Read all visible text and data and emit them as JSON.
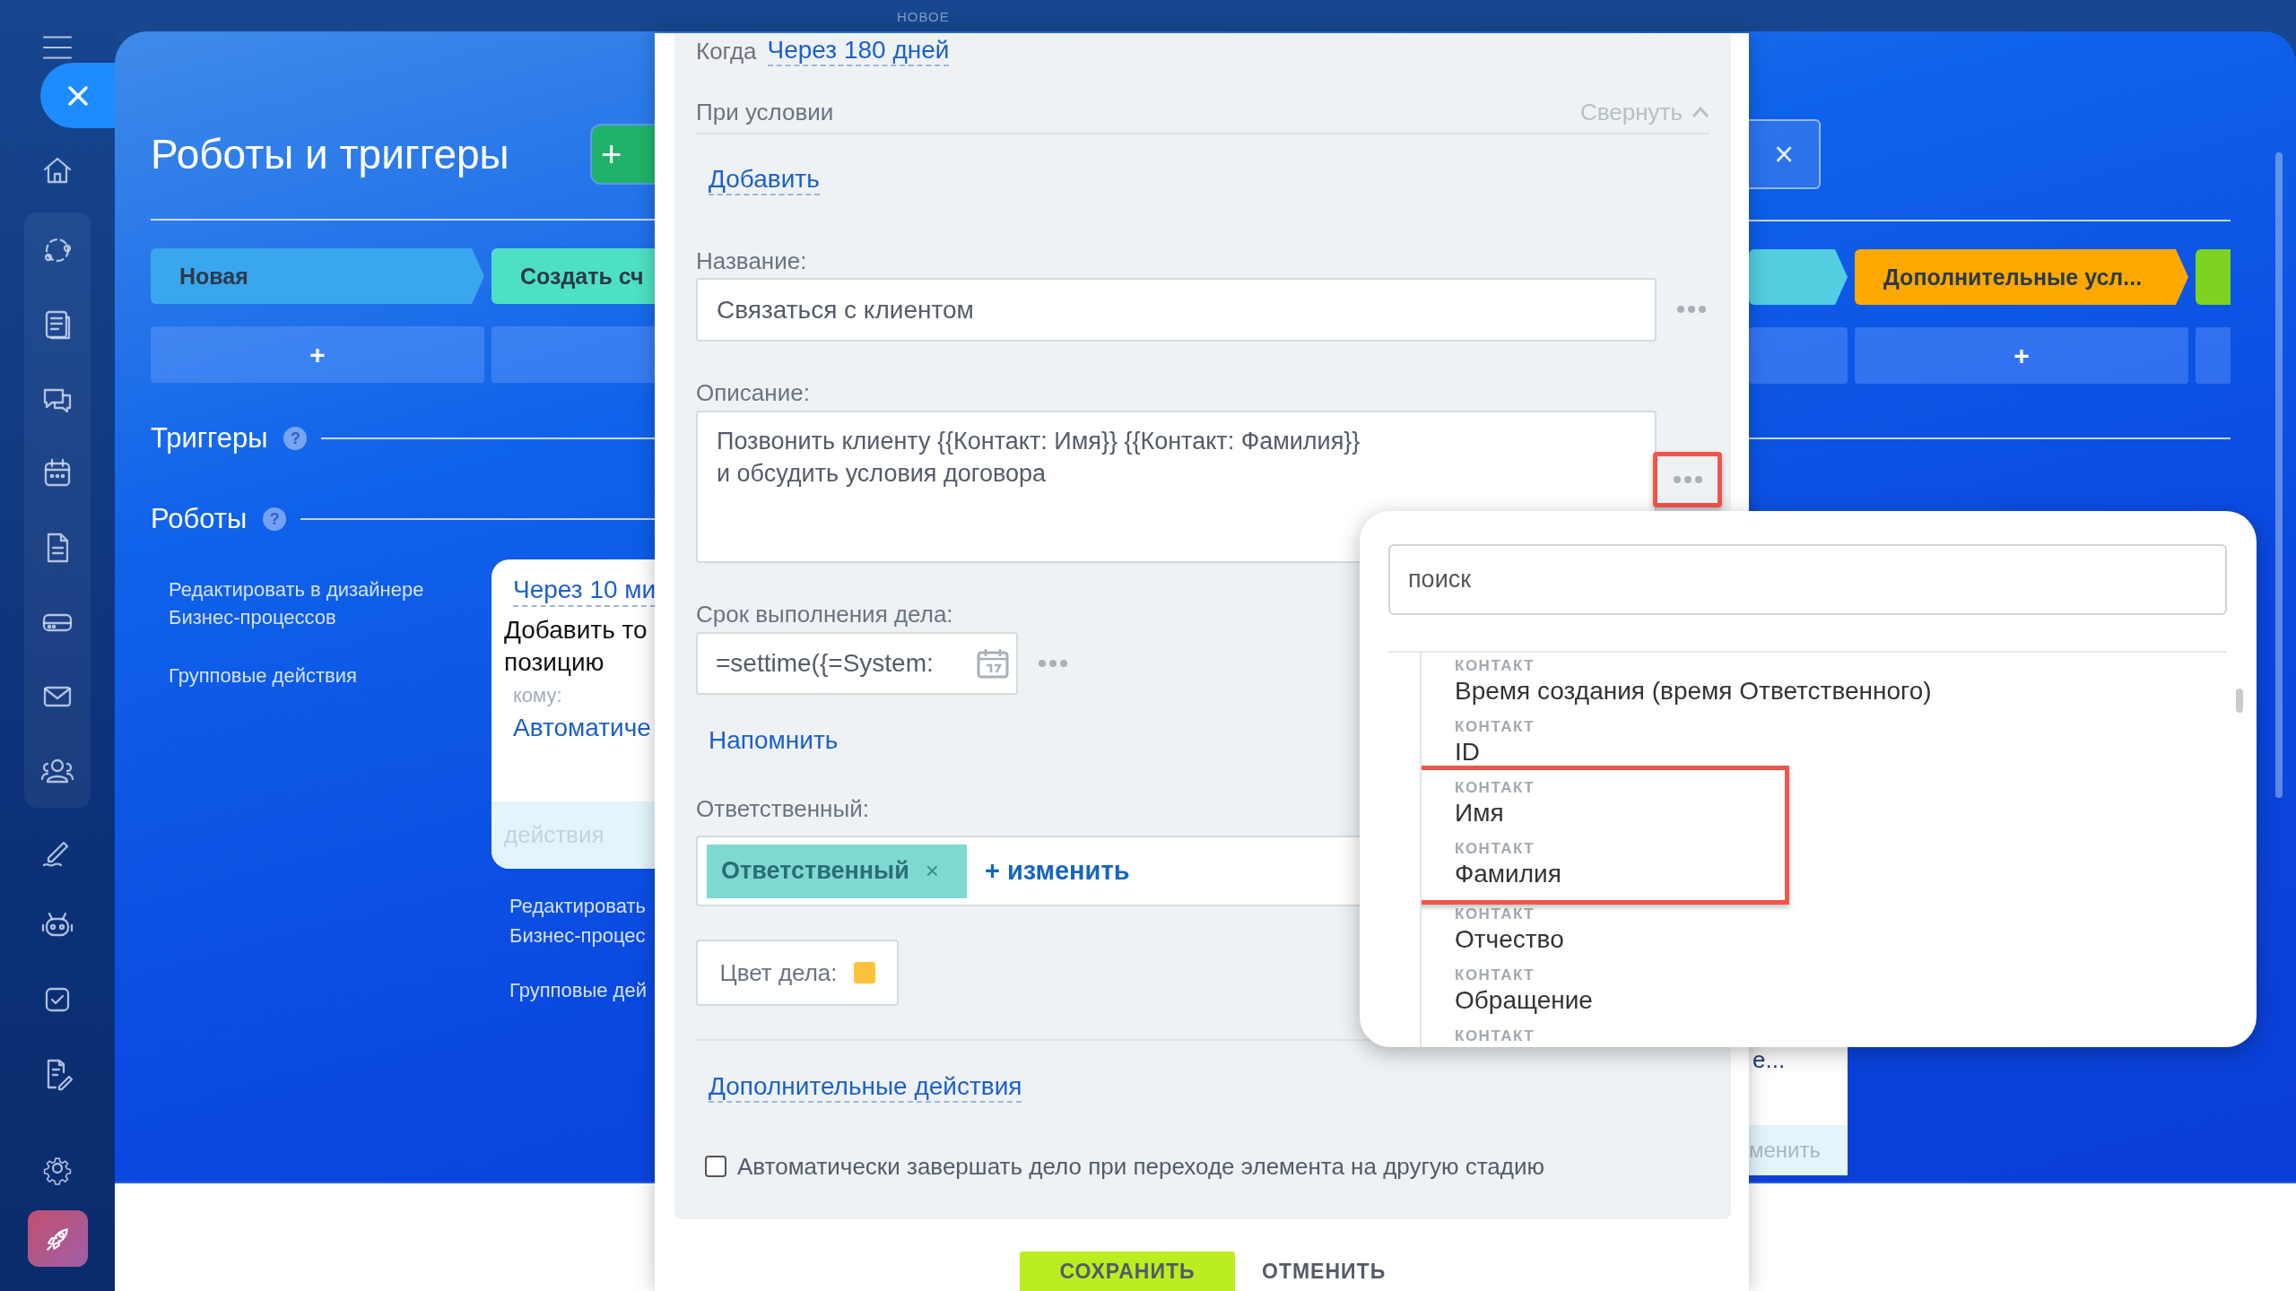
{
  "page": {
    "title": "Роботы и триггеры",
    "create_button": "+",
    "stages_left": [
      {
        "label": "Новая",
        "color": "#3aa6ee",
        "add": "+"
      },
      {
        "label": "Создать сч",
        "color": "#4ee0c4"
      }
    ],
    "stages_right": [
      {
        "color": "#54cde0"
      },
      {
        "label": "Дополнительные усл...",
        "color": "#ffa800",
        "add": "+"
      },
      {
        "color": "#7ed321"
      }
    ],
    "sections": [
      {
        "title": "Триггеры",
        "help": "?"
      },
      {
        "title": "Роботы",
        "help": "?"
      }
    ],
    "side_links": [
      "Редактировать в дизайнере Бизнес-процессов",
      "Групповые действия"
    ],
    "robot_card": {
      "delay": "Через 10 ми",
      "title_lines": [
        "Добавить то",
        "позицию"
      ],
      "recipient_label": "кому:",
      "recipient": "Автоматиче",
      "footer": "действия"
    },
    "card_links": [
      [
        "Редактировать",
        "Бизнес-процес"
      ],
      [
        "Групповые дей"
      ]
    ],
    "right_close": "×",
    "right_card": {
      "text": "е...",
      "link": "менить"
    }
  },
  "modal": {
    "badge": "НОВОЕ",
    "when_label": "Когда",
    "when_value": "Через 180 дней",
    "condition_label": "При условии",
    "collapse": "Свернуть",
    "add_condition": "Добавить",
    "name": {
      "label": "Название:",
      "value": "Связаться с клиентом",
      "highlighted": false
    },
    "description": {
      "label": "Описание:",
      "lines": [
        "Позвонить клиенту {{Контакт: Имя}} {{Контакт: Фамилия}}",
        "и обсудить условия договора"
      ],
      "highlighted": true
    },
    "deadline": {
      "label": "Срок выполнения дела:",
      "value": "=settime({=System:"
    },
    "remind": "Напомнить",
    "responsible": {
      "label": "Ответственный:",
      "chip": "Ответственный",
      "remove": "×",
      "change": "+ изменить"
    },
    "color": {
      "label": "Цвет дела:",
      "color": "#ffc23d"
    },
    "more_actions": "Дополнительные действия",
    "auto_complete": {
      "label": "Автоматически завершать дело при переходе элемента на другую стадию",
      "checked": false
    },
    "buttons": [
      {
        "label": "СОХРАНИТЬ",
        "kind": "primary"
      },
      {
        "label": "ОТМЕНИТЬ",
        "kind": "secondary"
      }
    ]
  },
  "field_picker": {
    "search": {
      "placeholder": "поиск"
    },
    "items": [
      {
        "category": "КОНТАКТ",
        "name": "Время создания (время Ответственного)",
        "highlighted": false
      },
      {
        "category": "КОНТАКТ",
        "name": "ID",
        "highlighted": false
      },
      {
        "category": "КОНТАКТ",
        "name": "Имя",
        "highlighted": true
      },
      {
        "category": "КОНТАКТ",
        "name": "Фамилия",
        "highlighted": true
      },
      {
        "category": "КОНТАКТ",
        "name": "Отчество",
        "highlighted": false
      },
      {
        "category": "КОНТАКТ",
        "name": "Обращение",
        "highlighted": false
      },
      {
        "category": "КОНТАКТ",
        "highlighted": false
      }
    ]
  }
}
